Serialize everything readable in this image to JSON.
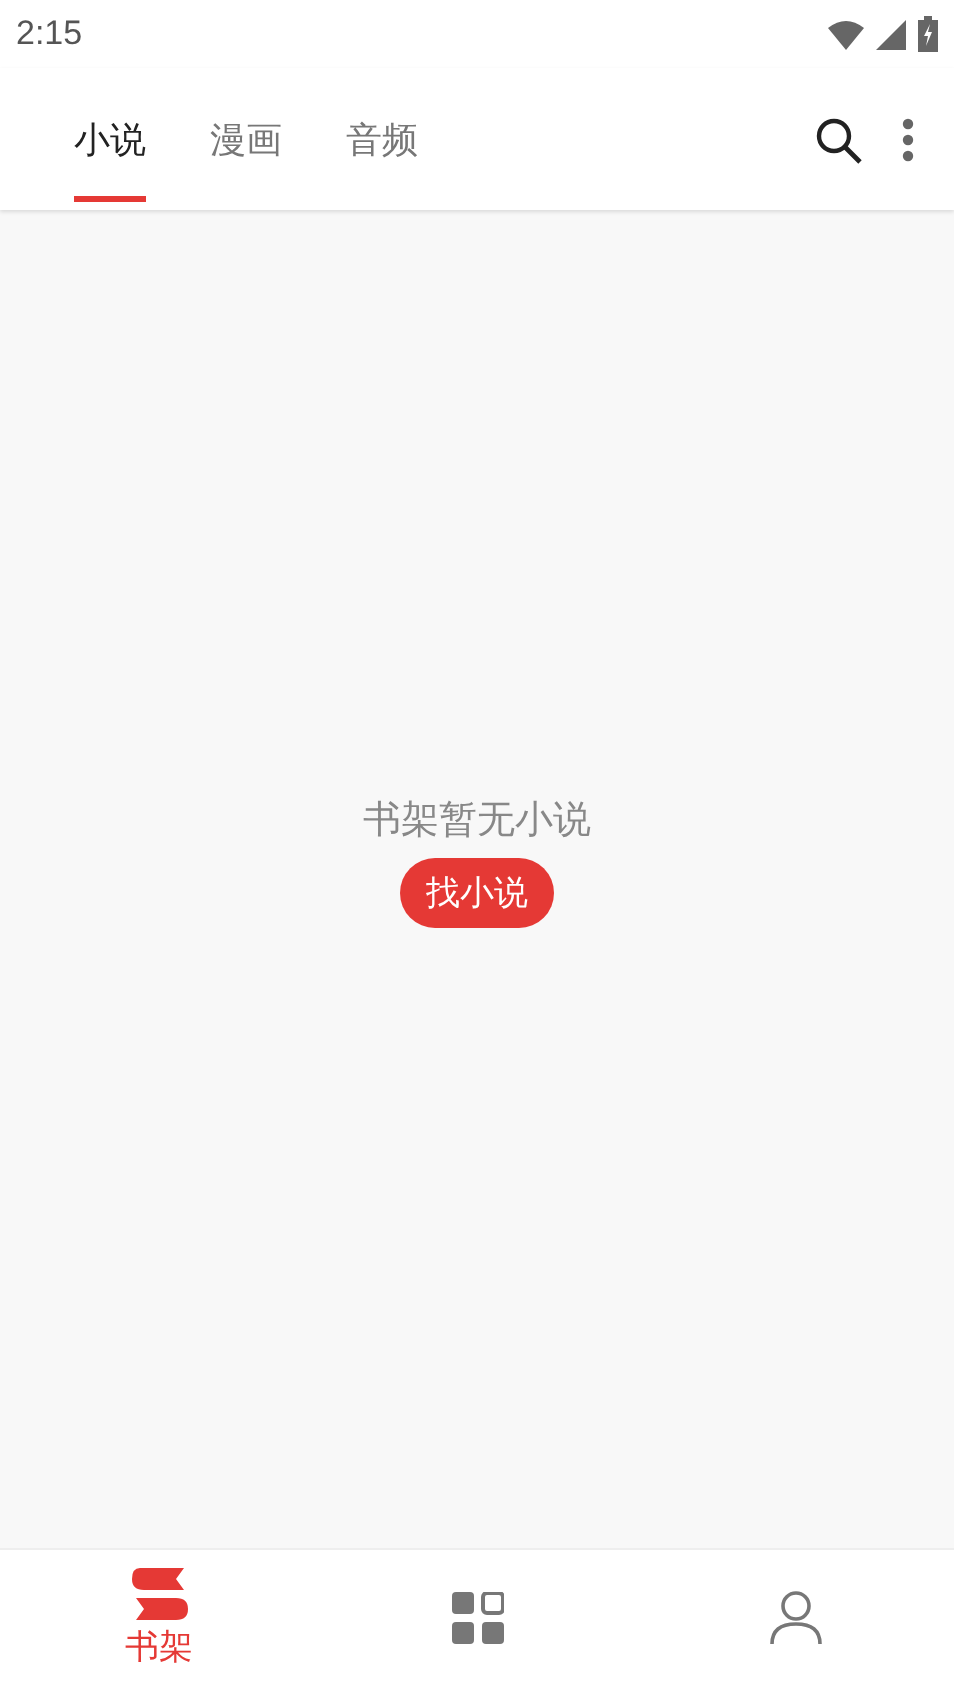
{
  "status_bar": {
    "time": "2:15"
  },
  "tabs": [
    {
      "label": "小说",
      "selected": true
    },
    {
      "label": "漫画",
      "selected": false
    },
    {
      "label": "音频",
      "selected": false
    }
  ],
  "empty_state": {
    "message": "书架暂无小说",
    "button": "找小说"
  },
  "bottom_nav": [
    {
      "kind": "shelf",
      "label": "书架",
      "selected": true
    },
    {
      "kind": "grid",
      "selected": false
    },
    {
      "kind": "person",
      "selected": false
    }
  ]
}
